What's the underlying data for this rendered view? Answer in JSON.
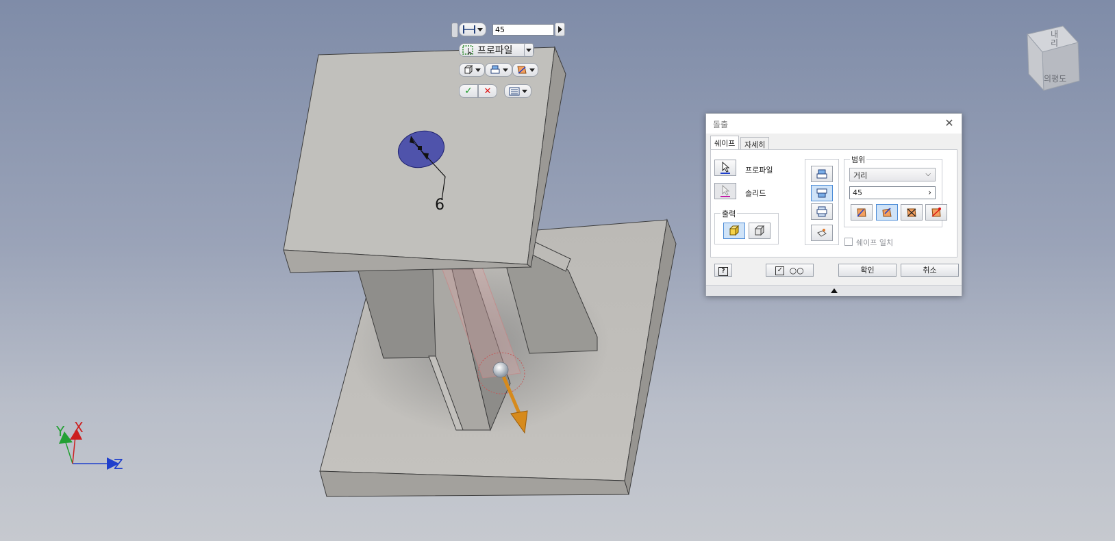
{
  "mini_toolbar": {
    "distance_value": "45",
    "profile_label": "프로파일"
  },
  "sketch": {
    "dimension_value": "6"
  },
  "dialog": {
    "title": "돌출",
    "tabs": [
      {
        "label": "쉐이프"
      },
      {
        "label": "자세히"
      }
    ],
    "profile_label": "프로파일",
    "solid_label": "솔리드",
    "output_group_label": "출력",
    "extents_group_label": "범위",
    "extents_type": "거리",
    "distance_value": "45",
    "match_shape_label": "쉐이프 일치",
    "ok_label": "확인",
    "cancel_label": "취소"
  },
  "viewcube": {
    "face_top": "내리",
    "face_front": "의평도"
  },
  "triad": {
    "x_label": "X",
    "y_label": "Y",
    "z_label": "Z"
  },
  "colors": {
    "accent": "#4a8ad6",
    "profile_fill": "#3b3fa8",
    "arrow": "#d68a1c",
    "x_axis": "#cc1f1f",
    "y_axis": "#22a033",
    "z_axis": "#1f3fcc"
  }
}
